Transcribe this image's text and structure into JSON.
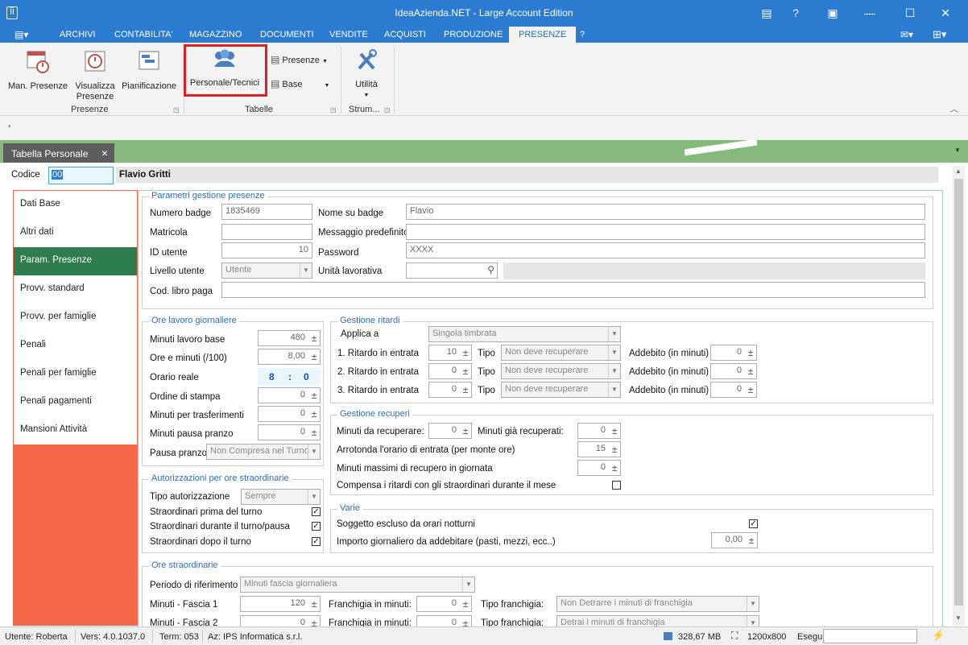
{
  "window": {
    "title": "IdeaAzienda.NET - Large Account Edition"
  },
  "menu": {
    "items": [
      "ARCHIVI",
      "CONTABILITA'",
      "MAGAZZINO",
      "DOCUMENTI",
      "VENDITE",
      "ACQUISTI",
      "PRODUZIONE",
      "PRESENZE",
      "?"
    ],
    "active": "PRESENZE"
  },
  "ribbon": {
    "man_presenze": "Man. Presenze",
    "visualizza_line1": "Visualizza",
    "visualizza_line2": "Presenze",
    "pianificazione": "Pianificazione",
    "group_presenze": "Presenze",
    "personale_tecnici": "Personale/Tecnici",
    "presenze_dd": "Presenze",
    "base_dd": "Base",
    "group_tabelle": "Tabelle",
    "utilita": "Utilità",
    "group_strum": "Strum..."
  },
  "doc_tab": {
    "label": "Tabella Personale",
    "close": "×"
  },
  "header": {
    "codice_label": "Codice",
    "codice_value": "00",
    "name": "Flavio Gritti"
  },
  "nav": {
    "items": [
      "Dati Base",
      "Altri dati",
      "Param. Presenze",
      "Provv. standard",
      "Provv. per famiglie",
      "Penali",
      "Penali per famiglie",
      "Penali pagamenti",
      "Mansioni Attività"
    ],
    "active": "Param. Presenze"
  },
  "parametri": {
    "legend": "Parametri gestione presenze",
    "numero_badge_label": "Numero badge",
    "numero_badge": "1835469",
    "nome_badge_label": "Nome su badge",
    "nome_badge": "Flavio",
    "matricola_label": "Matricola",
    "matricola": "",
    "messaggio_label": "Messaggio predefinito",
    "messaggio": "",
    "id_utente_label": "ID utente",
    "id_utente": "10",
    "password_label": "Password",
    "password": "XXXX",
    "livello_label": "Livello utente",
    "livello": "Utente",
    "unita_label": "Unità lavorativa",
    "unita": "",
    "libro_paga_label": "Cod. libro paga",
    "libro_paga": ""
  },
  "ore_lavoro": {
    "legend": "Ore lavoro giornaliere",
    "minuti_base_label": "Minuti lavoro base",
    "minuti_base": "480",
    "ore_minuti_label": "Ore e minuti (/100)",
    "ore_minuti": "8,00",
    "orario_reale_label": "Orario reale",
    "orario_h": "8",
    "orario_sep": ":",
    "orario_m": "0",
    "ordine_label": "Ordine di stampa",
    "ordine": "0",
    "trasferimenti_label": "Minuti per trasferimenti",
    "trasferimenti": "0",
    "pausa_min_label": "Minuti pausa pranzo",
    "pausa_min": "0",
    "pausa_label": "Pausa pranzo",
    "pausa": "Non Compresa nel Turno"
  },
  "autorizzazioni": {
    "legend": "Autorizzazioni per ore straordinarie",
    "tipo_label": "Tipo autorizzazione",
    "tipo": "Sempre",
    "prima_label": "Straordinari prima del turno",
    "prima": true,
    "durante_label": "Straordinari durante il turno/pausa",
    "durante": true,
    "dopo_label": "Straordinari dopo il turno",
    "dopo": true
  },
  "ore_straordinarie": {
    "legend": "Ore straordinarie",
    "periodo_label": "Periodo di riferimento",
    "periodo": "Minuti fascia giornaliera",
    "f1_label": "Minuti - Fascia 1",
    "f1": "120",
    "franchigia_label": "Franchigia in minuti:",
    "franchigia1": "0",
    "tipo_franchigia_label": "Tipo franchigia:",
    "tipo_franchigia1": "Non Detrarre i minuti di franchigia",
    "f2_label": "Minuti - Fascia 2",
    "f2": "0",
    "franchigia2": "0",
    "tipo_franchigia2": "Detrai i minuti di franchigia"
  },
  "ritardi": {
    "legend": "Gestione ritardi",
    "applica_label": "Applica a",
    "applica": "Singola timbrata",
    "rows": [
      {
        "label": "1. Ritardo in entrata",
        "value": "10",
        "tipo_label": "Tipo",
        "tipo": "Non deve recuperare",
        "addebito_label": "Addebito (in minuti)",
        "addebito": "0"
      },
      {
        "label": "2. Ritardo in entrata",
        "value": "0",
        "tipo_label": "Tipo",
        "tipo": "Non deve recuperare",
        "addebito_label": "Addebito (in minuti)",
        "addebito": "0"
      },
      {
        "label": "3. Ritardo in entrata",
        "value": "0",
        "tipo_label": "Tipo",
        "tipo": "Non deve recuperare",
        "addebito_label": "Addebito (in minuti)",
        "addebito": "0"
      }
    ]
  },
  "recuperi": {
    "legend": "Gestione recuperi",
    "da_recuperare_label": "Minuti da recuperare:",
    "da_recuperare": "0",
    "gia_recuperati_label": "Minuti già recuperati:",
    "gia_recuperati": "0",
    "arrotonda_label": "Arrotonda l'orario di entrata (per monte ore)",
    "arrotonda": "15",
    "massimi_label": "Minuti massimi di recupero in giornata",
    "massimi": "0",
    "compensa_label": "Compensa i ritardi con gli straordinari durante il mese",
    "compensa": false
  },
  "varie": {
    "legend": "Varie",
    "notturni_label": "Soggetto escluso da orari notturni",
    "notturni": true,
    "importo_label": "Importo giornaliero da addebitare (pasti, mezzi, ecc..)",
    "importo": "0,00"
  },
  "status": {
    "utente": "Utente: Roberta",
    "vers": "Vers: 4.0.1037.0",
    "term": "Term: 053",
    "az": "Az: IPS Informatica s.r.l.",
    "memory": "328,67 MB",
    "resolution": "1200x800",
    "esegui": "Esegui"
  },
  "colors": {
    "titlebar": "#2b7bd1",
    "nav_active": "#2e7d4e",
    "nav_bg": "#f5694a",
    "tabstrip": "#86b97c",
    "highlight": "#e02020"
  }
}
